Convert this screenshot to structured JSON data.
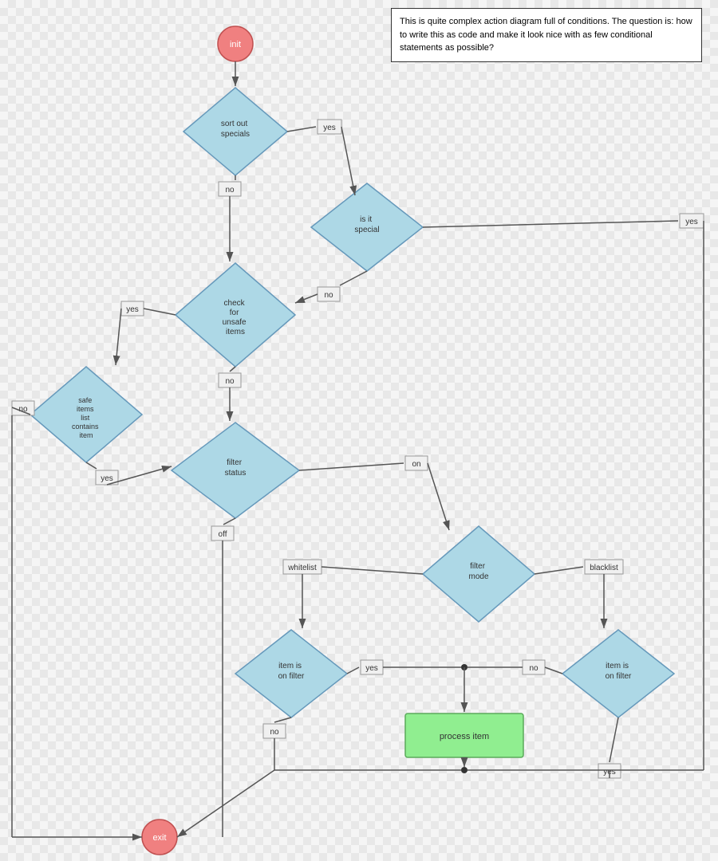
{
  "note": {
    "text": "This is quite complex action diagram full of conditions.  The question is: how to write this as code and make it look nice with as few conditional statements as possible?"
  },
  "nodes": {
    "init": "init",
    "sort_out_specials": "sort out\nspecials",
    "is_it_special": "is it\nspecial",
    "check_for_unsafe": "check\nfor\nunsafe\nitems",
    "safe_items": "safe\nitems\nlist\ncontains\nitem",
    "filter_status": "filter\nstatus",
    "filter_mode": "filter\nmode",
    "item_on_filter_left": "item is\non filter",
    "item_on_filter_right": "item is\non filter",
    "process_item": "process item",
    "exit": "exit"
  },
  "labels": {
    "yes": "yes",
    "no": "no",
    "on": "on",
    "off": "off",
    "whitelist": "whitelist",
    "blacklist": "blacklist"
  }
}
